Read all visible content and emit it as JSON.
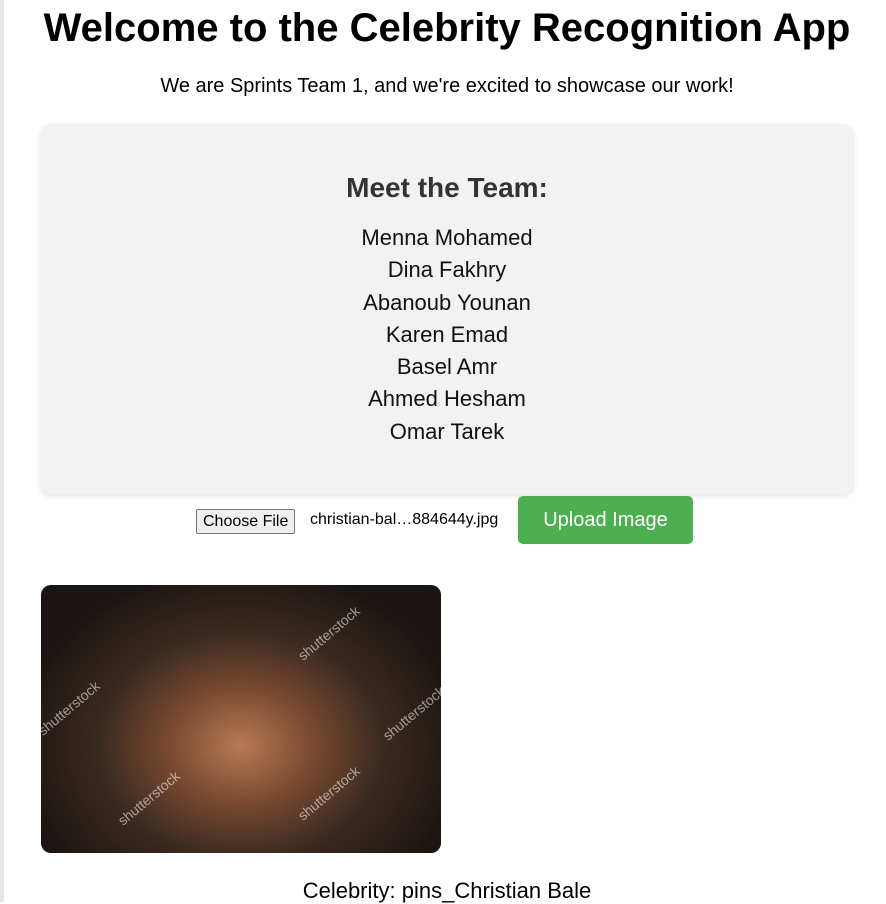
{
  "header": {
    "title": "Welcome to the Celebrity Recognition App",
    "subtitle": "We are Sprints Team 1, and we're excited to showcase our work!"
  },
  "team": {
    "heading": "Meet the Team:",
    "members": [
      "Menna Mohamed",
      "Dina Fakhry",
      "Abanoub Younan",
      "Karen Emad",
      "Basel Amr",
      "Ahmed Hesham",
      "Omar Tarek"
    ]
  },
  "upload": {
    "choose_label": "Choose File",
    "file_name": "christian-bal…884644y.jpg",
    "upload_label": "Upload Image"
  },
  "image": {
    "watermark": "shutterstock"
  },
  "result": {
    "text": "Celebrity: pins_Christian Bale"
  },
  "colors": {
    "accent": "#4caf50"
  }
}
